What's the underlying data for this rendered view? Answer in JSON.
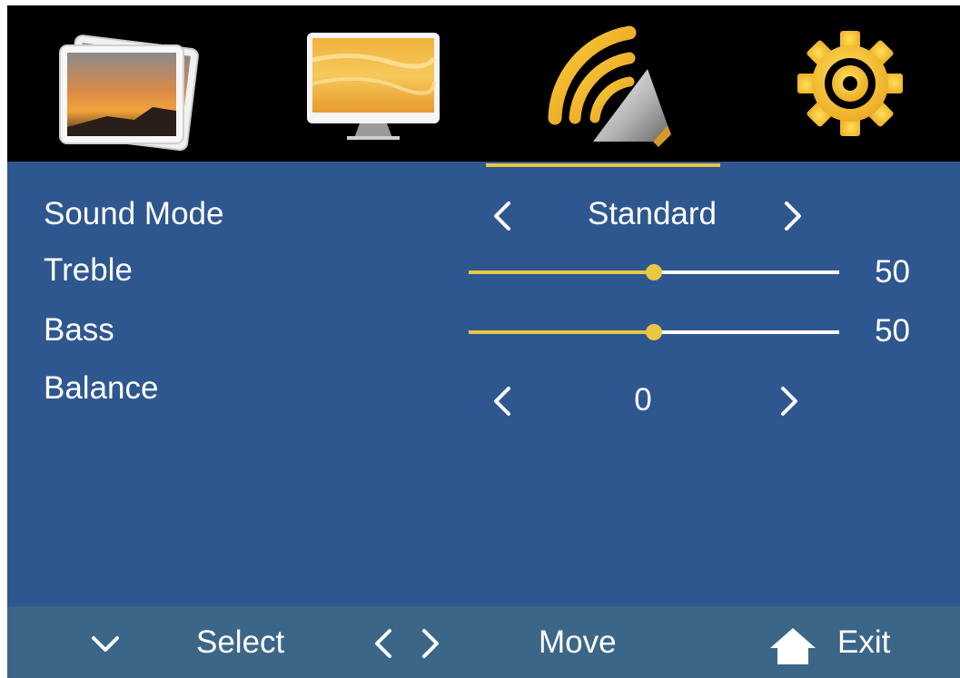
{
  "tabs": [
    {
      "name": "picture-gallery",
      "icon": "photos-icon",
      "selected": false
    },
    {
      "name": "screen",
      "icon": "monitor-icon",
      "selected": false
    },
    {
      "name": "sound",
      "icon": "sound-icon",
      "selected": true
    },
    {
      "name": "setup",
      "icon": "gear-icon",
      "selected": false
    }
  ],
  "menu": {
    "sound_mode": {
      "label": "Sound Mode",
      "value": "Standard"
    },
    "treble": {
      "label": "Treble",
      "value": 50,
      "display": "50",
      "max": 100
    },
    "bass": {
      "label": "Bass",
      "value": 50,
      "display": "50",
      "max": 100
    },
    "balance": {
      "label": "Balance",
      "value": "0"
    }
  },
  "footer": {
    "select_label": "Select",
    "move_label": "Move",
    "exit_label": "Exit",
    "icons": [
      "chevron-down-icon",
      "chevron-left-icon",
      "chevron-right-icon",
      "home-icon"
    ]
  },
  "colors": {
    "background": "#2e5790",
    "top_bar": "#000000",
    "footer": "#3b6688",
    "accent": "#e8c743",
    "text": "#ffffff"
  }
}
